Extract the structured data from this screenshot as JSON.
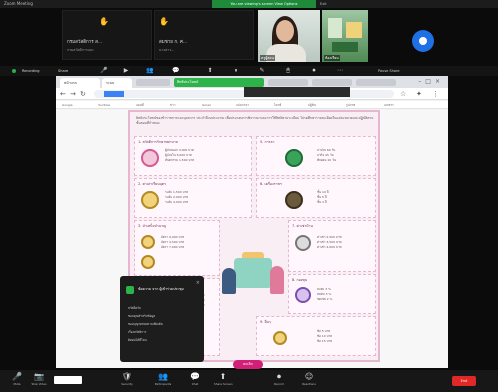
{
  "titlebar": {
    "app": "Zoom Meeting",
    "share_notice": "You are viewing's screen  View Options",
    "view_options": "Exit"
  },
  "participants": [
    {
      "name": "กรมสวัสดิการ ส...",
      "sub": "กรมสวัสดิการและ"
    },
    {
      "name": "สมชาย ก. ศ...",
      "sub": "นางสาว..."
    }
  ],
  "cams": [
    {
      "name": "ครูผู้สอน"
    },
    {
      "name": "ห้องเรียน"
    }
  ],
  "sharebar": {
    "recording": "Recording",
    "share_name": "Share",
    "right": "Pause Share"
  },
  "browser": {
    "tab1": "หน้าแรก",
    "tab2": "ระบบ",
    "green_tab": "สิทธิประโยชน์",
    "bookmarks": [
      "Google",
      "YouTube",
      "แผนที่",
      "ข่าว",
      "Gmail",
      "แปลภาษา",
      "ไดรฟ์",
      "ปฏิทิน",
      "รูปภาพ",
      "เอกสาร"
    ]
  },
  "doc": {
    "intro": "สิทธิประโยชน์ของข้าราชการและบุคลากร ประจำปีงบประมาณ เพื่อประกอบการพิจารณาและการใช้สิทธิตามระเบียบ โปรดศึกษารายละเอียดในแต่ละหมวดและปฏิบัติตามขั้นตอนที่กำหนด",
    "sections": [
      {
        "title": "1. สวัสดิการรักษาพยาบาล",
        "rows": [
          "ผู้ป่วยนอก  3,000 บาท",
          "ผู้ป่วยใน  5,000 บาท",
          "ทันตกรรม  1,500 บาท"
        ]
      },
      {
        "title": "2. ค่าเล่าเรียนบุตร",
        "rows": [
          "ระดับ  1,500 บาท",
          "ระดับ  2,000 บาท",
          "ระดับ  4,000 บาท"
        ]
      },
      {
        "title": "3. บำเหน็จบำนาญ",
        "rows": [
          "อัตรา  9,000 บาท",
          "อัตรา  4,500 บาท",
          "อัตรา  7,000 บาท"
        ]
      },
      {
        "title": "4. เงินช่วยเหลือ",
        "rows": [
          "ช่วย  3,000 บาท",
          "ช่วย  2,000 บาท",
          "ช่วย  1,000 บาท"
        ]
      },
      {
        "title": "5. การลา",
        "rows": [
          "ลาป่วย  60 วัน",
          "ลากิจ  45 วัน",
          "พักผ่อน  10 วัน"
        ]
      },
      {
        "title": "6. เครื่องราชฯ",
        "rows": [
          "ชั้น  10 ปี",
          "ชั้น  5 ปี",
          "ชั้น  3 ปี"
        ]
      },
      {
        "title": "7. ค่าเช่าบ้าน",
        "rows": [
          "ค่าเช่า  2,500 บาท",
          "ค่าเช่า  3,500 บาท",
          "ค่าเช่า  4,000 บาท"
        ]
      },
      {
        "title": "8. กองทุน",
        "rows": [
          "สะสม  3 %",
          "สมทบ  3 %",
          "ชดเชย  2 %"
        ]
      },
      {
        "title": "9. อื่นๆ",
        "rows": [
          "ข้อ  5 บาท",
          "ข้อ  10 บาท",
          "ข้อ  15 บาท"
        ]
      }
    ]
  },
  "toast": {
    "title": "ข้อความ จาก ผู้เข้าร่วมประชุม",
    "lines": [
      "สวัสดีครับ",
      "ขอบคุณสำหรับข้อมูล",
      "ขออนุญาตสอบถามเพิ่มเติม",
      "เรื่องสวัสดิการ",
      "ติดต่อได้ที่ไหน"
    ]
  },
  "pill_label": "ยกเลิก",
  "controls": {
    "items": [
      {
        "icon": "🎤",
        "label": "Mute"
      },
      {
        "icon": "📷",
        "label": "Stop Video"
      },
      {
        "icon": "🛡",
        "label": "Security"
      },
      {
        "icon": "👥",
        "label": "Participants"
      },
      {
        "icon": "💬",
        "label": "Chat"
      },
      {
        "icon": "⬆",
        "label": "Share Screen"
      },
      {
        "icon": "⏺",
        "label": "Record"
      },
      {
        "icon": "☺",
        "label": "Reactions"
      }
    ],
    "end": "End"
  },
  "colors": {
    "accent": "#2db34a",
    "doc_border": "#e7b6cf",
    "end": "#e02828",
    "pill": "#d21f77"
  }
}
